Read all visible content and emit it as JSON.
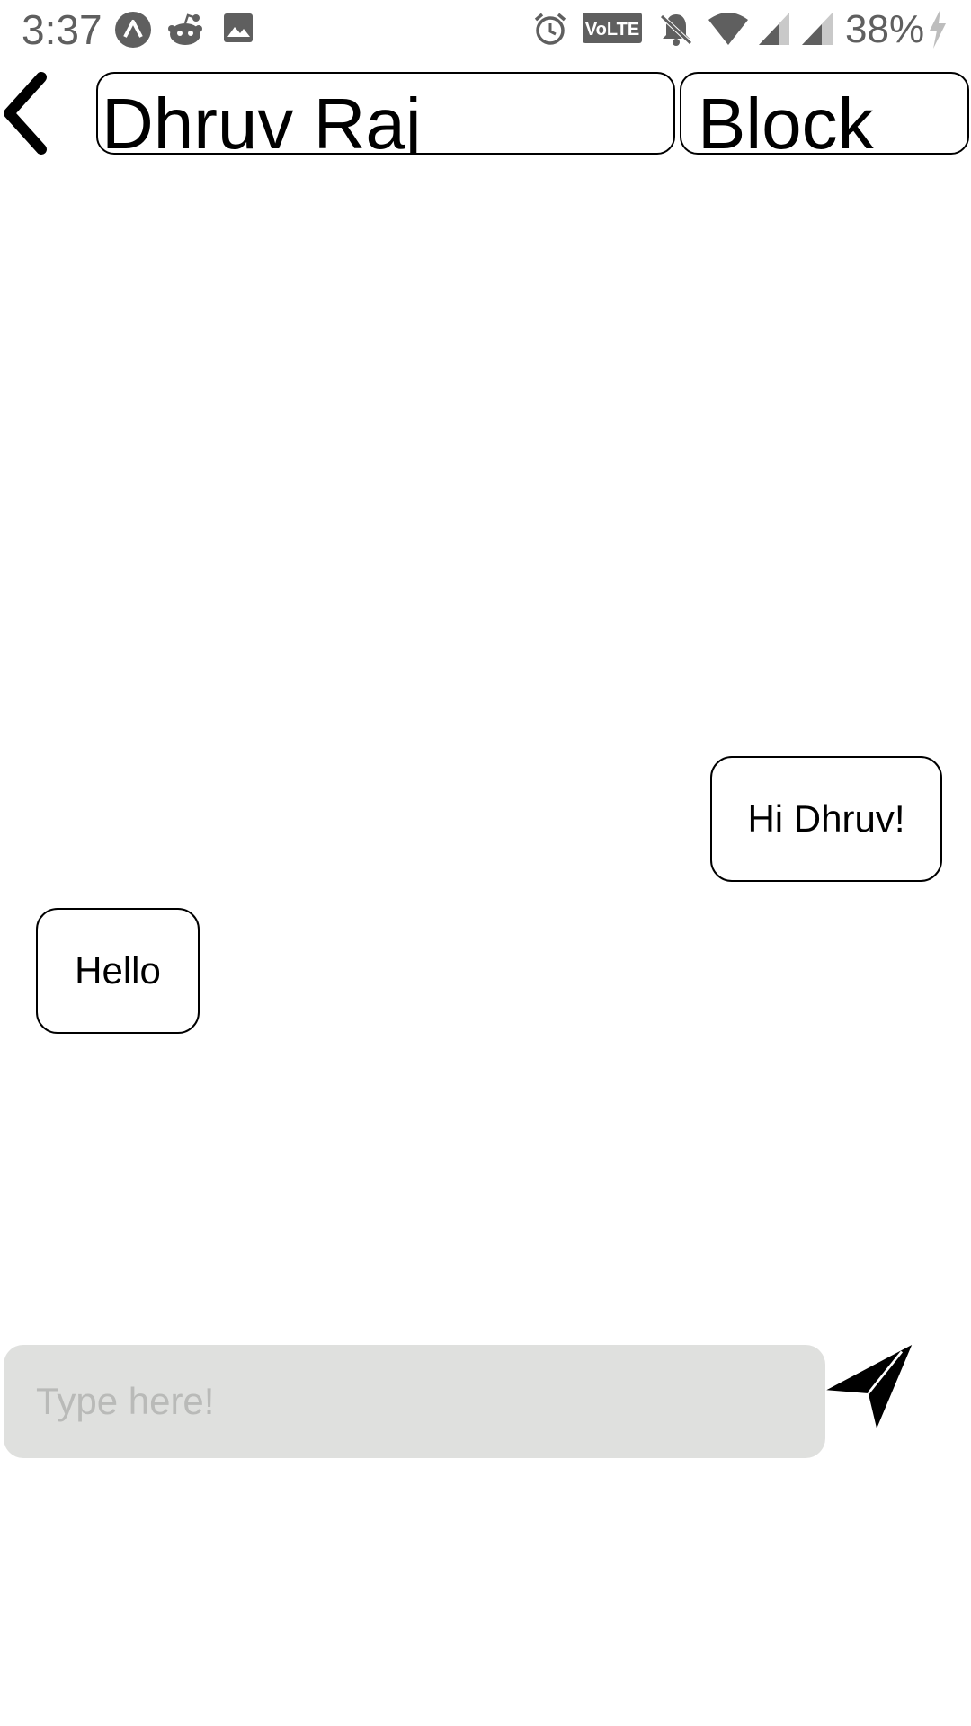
{
  "status_bar": {
    "time": "3:37",
    "battery_percent": "38%",
    "volte_label": "VoLTE",
    "icons": [
      "app-a-icon",
      "reddit-icon",
      "image-icon",
      "alarm-icon",
      "volte-icon",
      "notifications-off-icon",
      "wifi-icon",
      "signal-icon",
      "signal-icon",
      "charging-icon"
    ]
  },
  "header": {
    "back_icon": "chevron-left-icon",
    "contact_name": "Dhruv Raj",
    "block_label": "Block"
  },
  "messages": [
    {
      "text": "Hi Dhruv!",
      "side": "right"
    },
    {
      "text": "Hello",
      "side": "left"
    }
  ],
  "composer": {
    "placeholder": "Type here!",
    "value": "",
    "send_icon": "send-icon"
  },
  "colors": {
    "input_background": "#dfe0de",
    "placeholder": "#b9bab8",
    "status_icons": "#5f5f5f"
  }
}
